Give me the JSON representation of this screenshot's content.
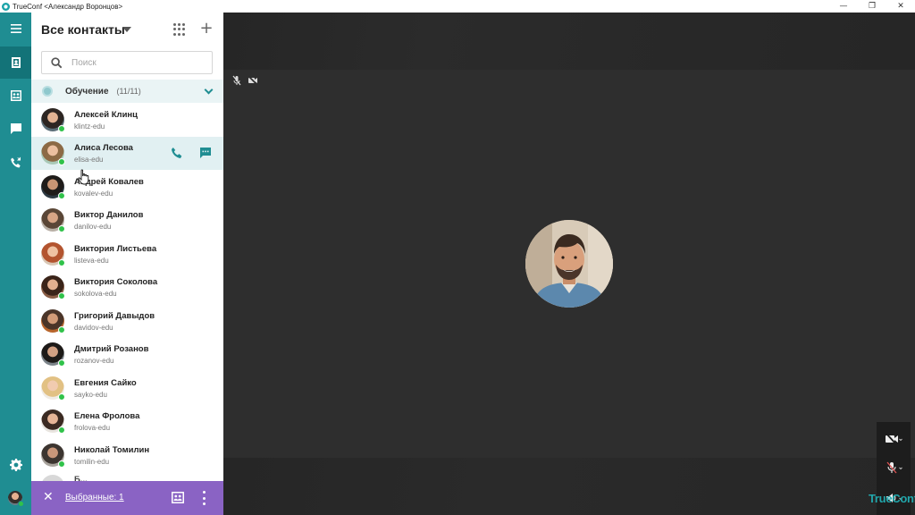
{
  "window": {
    "title": "TrueConf <Александр Воронцов>",
    "minimize": "—",
    "restore": "❐",
    "close": "✕"
  },
  "rail": {
    "items": [
      "menu-icon",
      "contacts-icon",
      "conference-icon",
      "chat-icon",
      "call-history-icon"
    ],
    "active": "contacts-icon",
    "settings": "gear-icon"
  },
  "contacts_panel": {
    "title": "Все контакты",
    "search": {
      "placeholder": "Поиск",
      "value": ""
    },
    "group": {
      "name": "Обучение",
      "count": "(11/11)",
      "expanded": true
    },
    "contacts": [
      {
        "name": "Алексей Клинц",
        "login": "klintz-edu",
        "online": true
      },
      {
        "name": "Алиса Лесова",
        "login": "elisa-edu",
        "online": true,
        "selected": true
      },
      {
        "name": "Андрей Ковалев",
        "login": "kovalev-edu",
        "online": true
      },
      {
        "name": "Виктор Данилов",
        "login": "danilov-edu",
        "online": true
      },
      {
        "name": "Виктория Листьева",
        "login": "listeva-edu",
        "online": true
      },
      {
        "name": "Виктория Соколова",
        "login": "sokolova-edu",
        "online": true
      },
      {
        "name": "Григорий Давыдов",
        "login": "davidov-edu",
        "online": true
      },
      {
        "name": "Дмитрий Розанов",
        "login": "rozanov-edu",
        "online": true
      },
      {
        "name": "Евгения Сайко",
        "login": "sayko-edu",
        "online": true
      },
      {
        "name": "Елена Фролова",
        "login": "frolova-edu",
        "online": true
      },
      {
        "name": "Николай Томилин",
        "login": "tomilin-edu",
        "online": true
      }
    ],
    "partial_row_text": "Б..."
  },
  "selection_bar": {
    "close": "✕",
    "label": "Выбранные: 1",
    "color": "#8a63c4"
  },
  "stage": {
    "brand": "TrueConf"
  },
  "colors": {
    "accent": "#1f8d92",
    "online": "#30c24a"
  }
}
